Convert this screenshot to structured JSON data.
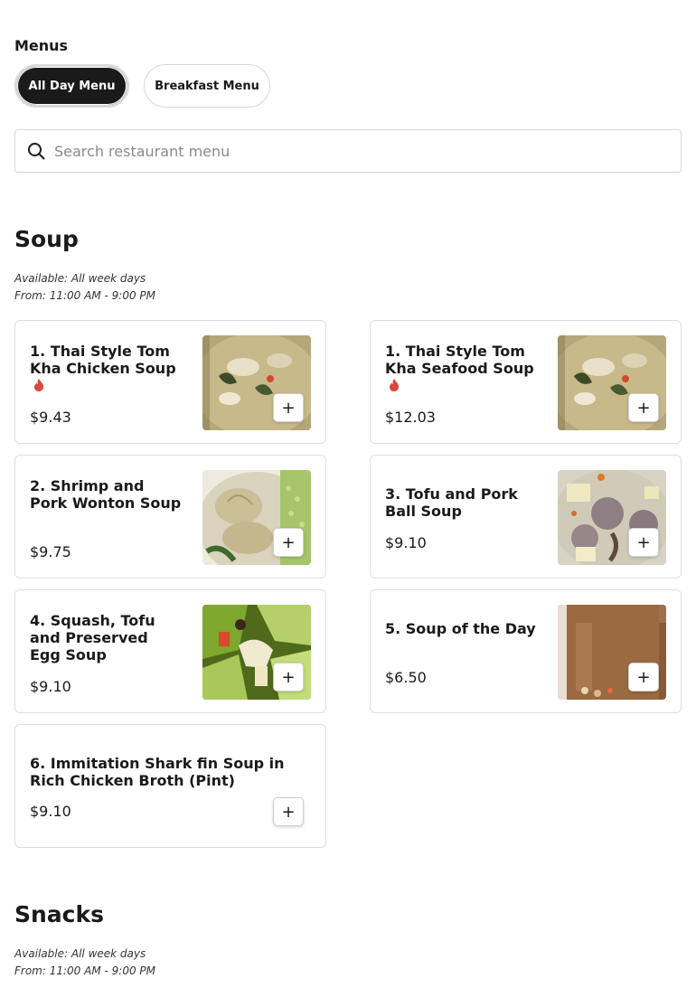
{
  "menus": {
    "label": "Menus",
    "tabs": [
      {
        "label": "All Day Menu",
        "active": true
      },
      {
        "label": "Breakfast Menu",
        "active": false
      }
    ]
  },
  "search": {
    "placeholder": "Search restaurant menu",
    "icon": "search-icon"
  },
  "sections": [
    {
      "title": "Soup",
      "available": "Available: All week days",
      "hours": "From: 11:00 AM - 9:00 PM",
      "items": [
        {
          "name": "1. Thai Style Tom Kha Chicken Soup",
          "price": "$9.43",
          "spicy": true,
          "image": "coconut-soup-photo"
        },
        {
          "name": "1. Thai Style Tom Kha Seafood Soup",
          "price": "$12.03",
          "spicy": true,
          "image": "coconut-soup-photo"
        },
        {
          "name": "2. Shrimp and Pork Wonton Soup",
          "price": "$9.75",
          "spicy": false,
          "image": "wonton-soup-photo"
        },
        {
          "name": "3. Tofu and Pork Ball Soup",
          "price": "$9.10",
          "spicy": false,
          "image": "pork-ball-soup-photo"
        },
        {
          "name": "4. Squash, Tofu and Preserved Egg Soup",
          "price": "$9.10",
          "spicy": false,
          "image": "squash-soup-photo"
        },
        {
          "name": "5. Soup of the Day",
          "price": "$6.50",
          "spicy": false,
          "image": "broth-photo"
        },
        {
          "name": "6. Immitation Shark fin Soup in Rich Chicken Broth (Pint)",
          "price": "$9.10",
          "spicy": false,
          "image": null
        }
      ]
    },
    {
      "title": "Snacks",
      "available": "Available: All week days",
      "hours": "From: 11:00 AM - 9:00 PM",
      "items": []
    }
  ],
  "add_label": "+",
  "colors": {
    "active_pill": "#1a1a1a",
    "spicy": "#d9473d",
    "border": "#dedede"
  }
}
